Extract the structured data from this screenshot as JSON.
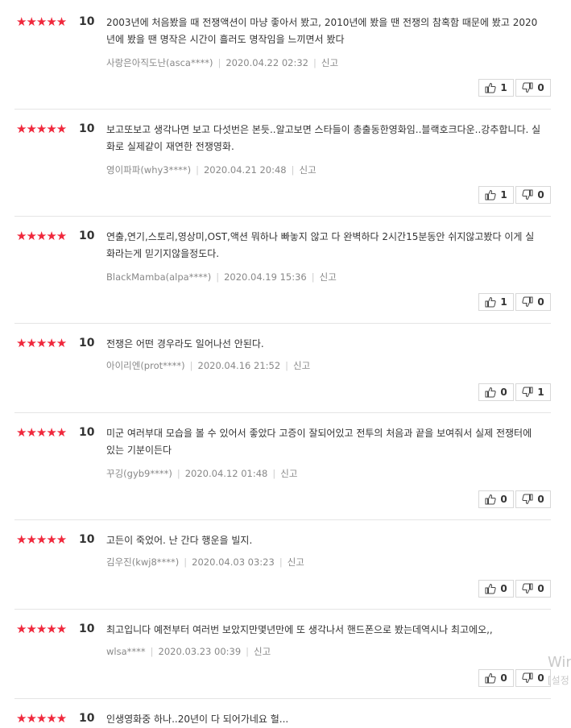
{
  "reviews": [
    {
      "stars": "★★★★★",
      "score": "10",
      "text": "2003년에 처음봤을 때 전쟁액션이 마냥 좋아서 봤고, 2010년에 봤을 땐 전쟁의 참혹함 때문에 봤고 2020년에 봤을 땐 명작은 시간이 흘러도 명작임을 느끼면서 봤다",
      "user": "사랑은아직도난(asca****)",
      "date": "2020.04.22 02:32",
      "report": "신고",
      "up": "1",
      "down": "0"
    },
    {
      "stars": "★★★★★",
      "score": "10",
      "text": "보고또보고 생각나면 보고 다섯번은 본듯..알고보면 스타들이 총출동한영화임..블랙호크다운..강추합니다. 실화로 실제같이 재연한 전쟁영화.",
      "user": "영이파파(why3****)",
      "date": "2020.04.21 20:48",
      "report": "신고",
      "up": "1",
      "down": "0"
    },
    {
      "stars": "★★★★★",
      "score": "10",
      "text": "연출,연기,스토리,영상미,OST,액션 뭐하나 빠놓지 않고 다 완벽하다 2시간15분동안 쉬지않고봤다 이게 실화라는게 믿기지않을정도다.",
      "user": "BlackMamba(alpa****)",
      "date": "2020.04.19 15:36",
      "report": "신고",
      "up": "1",
      "down": "0"
    },
    {
      "stars": "★★★★★",
      "score": "10",
      "text": "전쟁은 어떤 경우라도 일어나선 안된다.",
      "user": "아이리엔(prot****)",
      "date": "2020.04.16 21:52",
      "report": "신고",
      "up": "0",
      "down": "1"
    },
    {
      "stars": "★★★★★",
      "score": "10",
      "text": "미군 여러부대 모습을 볼 수 있어서 좋았다 고증이 잘되어있고 전투의 처음과 끝을 보여줘서 실제 전쟁터에 있는 기분이든다",
      "user": "꾸깅(gyb9****)",
      "date": "2020.04.12 01:48",
      "report": "신고",
      "up": "0",
      "down": "0"
    },
    {
      "stars": "★★★★★",
      "score": "10",
      "text": "고든이 죽었어. 난 간다 행운을 빌지.",
      "user": "김우진(kwj8****)",
      "date": "2020.04.03 03:23",
      "report": "신고",
      "up": "0",
      "down": "0"
    },
    {
      "stars": "★★★★★",
      "score": "10",
      "text": "최고입니다 예전부터 여러번 보았지만몇년만에 또 생각나서 핸드폰으로 봤는데역시나 최고에오,,",
      "user": "wlsa****",
      "date": "2020.03.23 00:39",
      "report": "신고",
      "up": "0",
      "down": "0"
    },
    {
      "stars": "★★★★★",
      "score": "10",
      "text": "인생영화중 하나..20년이 다 되어가네요 헐...",
      "user": "",
      "date": "",
      "report": "",
      "up": "",
      "down": ""
    }
  ],
  "watermark": {
    "line1": "Wir",
    "line2": "[설정"
  }
}
